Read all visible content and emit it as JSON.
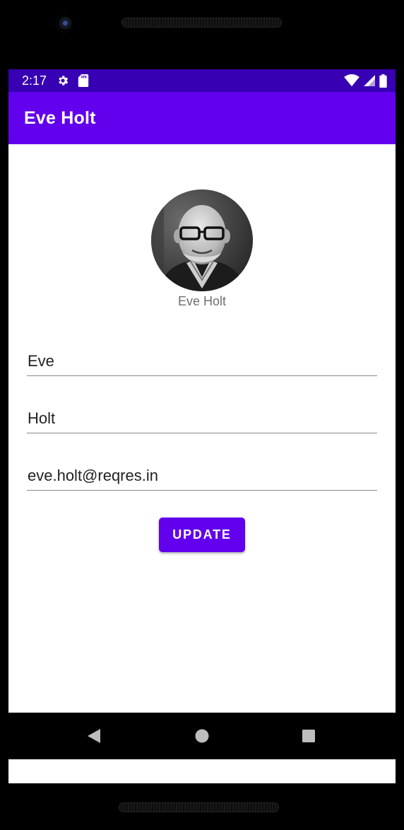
{
  "status_bar": {
    "time": "2:17",
    "icons": [
      "gear-icon",
      "sd-card-icon",
      "wifi-icon",
      "cell-signal-icon",
      "battery-icon"
    ]
  },
  "app_bar": {
    "title": "Eve Holt"
  },
  "profile": {
    "avatar_caption": "Eve Holt"
  },
  "form": {
    "first_name": "Eve",
    "last_name": "Holt",
    "email": "eve.holt@reqres.in"
  },
  "actions": {
    "update_label": "UPDATE"
  },
  "nav_bar": {
    "icons": [
      "back-icon",
      "home-icon",
      "recents-icon"
    ]
  },
  "colors": {
    "status_bar": "#3700b3",
    "primary": "#6200ee",
    "on_primary": "#ffffff"
  }
}
